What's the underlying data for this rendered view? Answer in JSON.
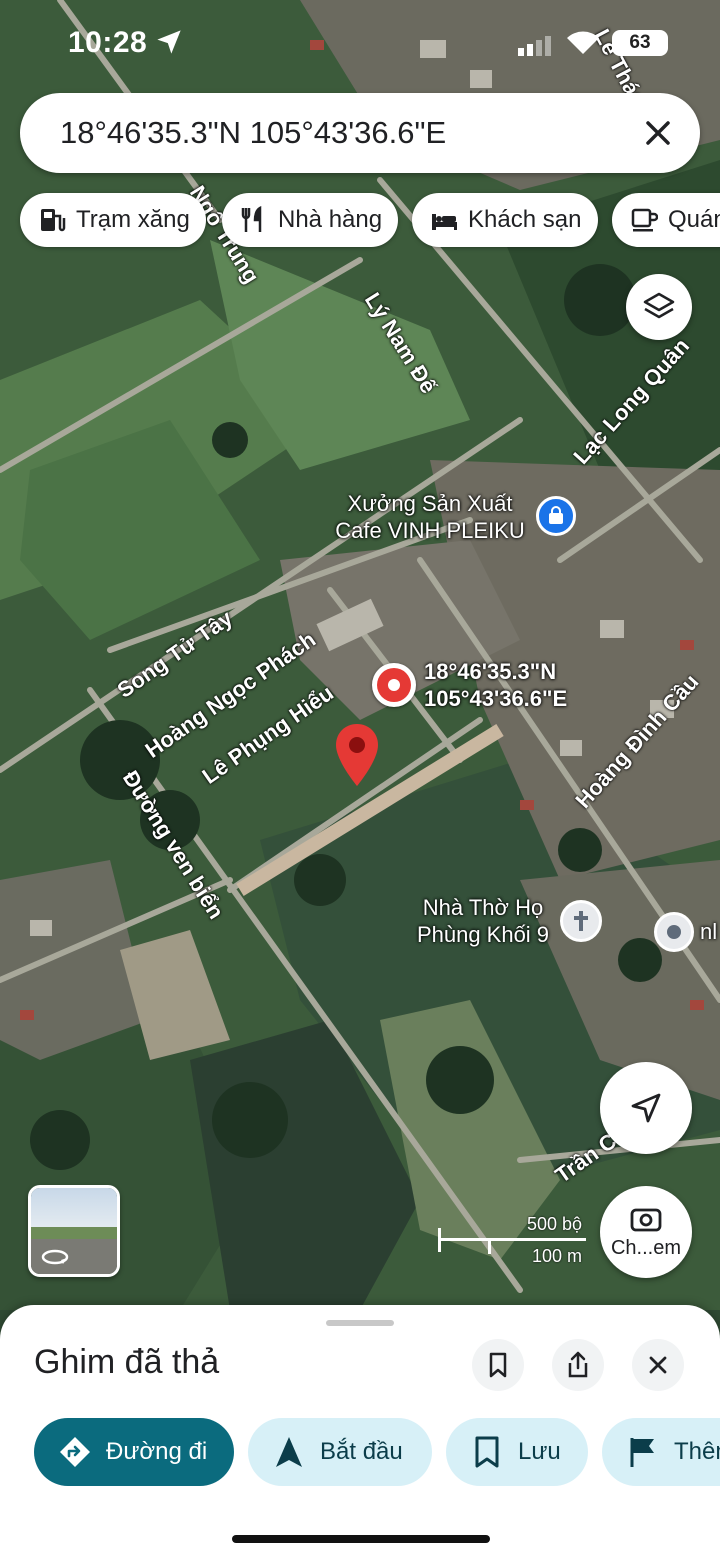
{
  "status_bar": {
    "time": "10:28",
    "battery": "63"
  },
  "search": {
    "query": "18°46'35.3\"N 105°43'36.6\"E"
  },
  "chips": [
    {
      "label": "Trạm xăng",
      "icon": "gas-station-icon"
    },
    {
      "label": "Nhà hàng",
      "icon": "restaurant-icon"
    },
    {
      "label": "Khách sạn",
      "icon": "hotel-bed-icon"
    },
    {
      "label": "Quán",
      "icon": "coffee-cup-icon"
    }
  ],
  "map": {
    "streets": {
      "le_thanh": "Lê Thán",
      "ngo_trung": "Ngô Trung",
      "ly_nam_de": "Lý Nam Đế",
      "lac_long_quan": "Lạc Long Quân",
      "song_tu_tay": "Song Tử Tây",
      "hoang_ngoc_phach": "Hoàng Ngọc Phách",
      "le_phung_hieu": "Lê Phụng Hiểu",
      "duong_ven_bien": "Đường ven biển",
      "hoang_dinh_cau": "Hoàng Đình Cầu",
      "tran": "Trần C"
    },
    "pois": {
      "factory_line1": "Xưởng Sản Xuất",
      "factory_line2": "Cafe VINH PLEIKU",
      "pin_line1": "18°46'35.3\"N",
      "pin_line2": "105°43'36.6\"E",
      "church_line1": "Nhà Thờ Họ",
      "church_line2": "Phùng Khối 9",
      "edge_label": "nl"
    },
    "scale": {
      "imperial": "500 bộ",
      "metric": "100 m"
    },
    "camera_button_label": "Ch...em"
  },
  "sheet": {
    "title": "Ghim đã thả",
    "actions": [
      {
        "label": "Đường đi",
        "icon": "directions-icon"
      },
      {
        "label": "Bắt đầu",
        "icon": "navigation-arrow-icon"
      },
      {
        "label": "Lưu",
        "icon": "bookmark-icon"
      },
      {
        "label": "Thêm",
        "icon": "flag-icon"
      }
    ]
  },
  "colors": {
    "primary_button": "#0b6b7e",
    "secondary_button": "#d7f0f7",
    "pin_red": "#e53935",
    "poi_blue": "#1a73e8"
  }
}
